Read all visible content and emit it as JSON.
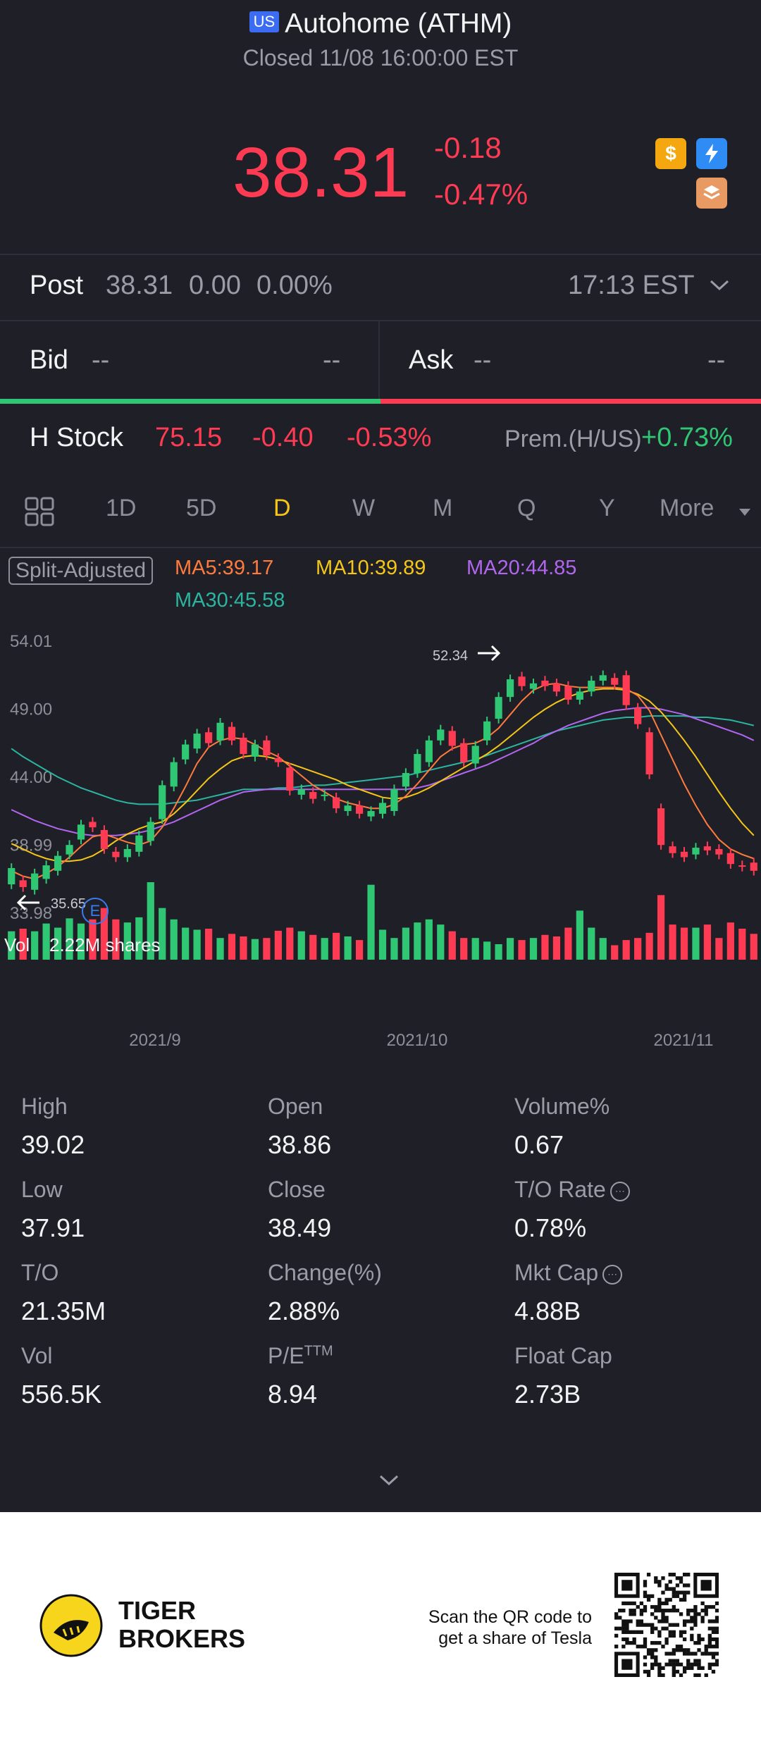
{
  "header": {
    "market_badge": "US",
    "title": "Autohome (ATHM)",
    "status": "Closed 11/08 16:00:00 EST"
  },
  "quote": {
    "price": "38.31",
    "change": "-0.18",
    "change_pct": "-0.47%"
  },
  "post": {
    "label": "Post",
    "price": "38.31",
    "change": "0.00",
    "change_pct": "0.00%",
    "time": "17:13 EST"
  },
  "bid_ask": {
    "bid_label": "Bid",
    "bid_price": "--",
    "bid_size": "--",
    "ask_label": "Ask",
    "ask_price": "--",
    "ask_size": "--"
  },
  "h_stock": {
    "label": "H Stock",
    "price": "75.15",
    "change": "-0.40",
    "change_pct": "-0.53%",
    "prem_label": "Prem.(H/US)",
    "prem_value": "+0.73%"
  },
  "tabs": [
    "1D",
    "5D",
    "D",
    "W",
    "M",
    "Q",
    "Y",
    "More"
  ],
  "active_tab": "D",
  "chart_info": {
    "split_label": "Split-Adjusted",
    "ma5": "MA5:39.17",
    "ma10": "MA10:39.89",
    "ma20": "MA20:44.85",
    "ma30": "MA30:45.58",
    "max_label": "52.34",
    "min_label": "35.65",
    "earnings_marker": "E",
    "vol_label": "Vol",
    "vol_value": "2.22M shares"
  },
  "colors": {
    "up": "#2fc774",
    "down": "#ff3b54",
    "ma5": "#ff7a3d",
    "ma10": "#f5c518",
    "ma20": "#b266f0",
    "ma30": "#2bb5a0"
  },
  "chart_data": {
    "type": "candlestick",
    "y_ticks": [
      "54.01",
      "49.00",
      "44.00",
      "38.99",
      "33.98"
    ],
    "ylim": [
      33.98,
      54.01
    ],
    "x_ticks": [
      "2021/9",
      "2021/10",
      "2021/11"
    ],
    "candles": [
      {
        "o": 36.0,
        "c": 37.2
      },
      {
        "o": 36.3,
        "c": 35.8
      },
      {
        "o": 35.6,
        "c": 36.8
      },
      {
        "o": 36.4,
        "c": 37.4
      },
      {
        "o": 37.0,
        "c": 38.1
      },
      {
        "o": 38.2,
        "c": 38.9
      },
      {
        "o": 39.3,
        "c": 40.4
      },
      {
        "o": 40.6,
        "c": 40.2
      },
      {
        "o": 40.0,
        "c": 38.6
      },
      {
        "o": 38.4,
        "c": 38.0
      },
      {
        "o": 38.0,
        "c": 38.6
      },
      {
        "o": 38.4,
        "c": 39.6
      },
      {
        "o": 39.2,
        "c": 40.6
      },
      {
        "o": 40.8,
        "c": 43.3
      },
      {
        "o": 43.2,
        "c": 45.0
      },
      {
        "o": 45.2,
        "c": 46.3
      },
      {
        "o": 46.0,
        "c": 47.1
      },
      {
        "o": 47.2,
        "c": 46.4
      },
      {
        "o": 46.6,
        "c": 47.9
      },
      {
        "o": 47.6,
        "c": 46.6
      },
      {
        "o": 46.8,
        "c": 45.6
      },
      {
        "o": 45.4,
        "c": 46.3
      },
      {
        "o": 46.6,
        "c": 45.5
      },
      {
        "o": 45.3,
        "c": 45.0
      },
      {
        "o": 44.6,
        "c": 42.9
      },
      {
        "o": 42.6,
        "c": 43.0
      },
      {
        "o": 42.8,
        "c": 42.3
      },
      {
        "o": 42.5,
        "c": 42.6
      },
      {
        "o": 42.4,
        "c": 41.6
      },
      {
        "o": 41.4,
        "c": 41.8
      },
      {
        "o": 41.8,
        "c": 41.2
      },
      {
        "o": 41.0,
        "c": 41.4
      },
      {
        "o": 41.2,
        "c": 42.0
      },
      {
        "o": 41.4,
        "c": 43.0
      },
      {
        "o": 43.2,
        "c": 44.2
      },
      {
        "o": 44.2,
        "c": 45.6
      },
      {
        "o": 45.0,
        "c": 46.6
      },
      {
        "o": 46.6,
        "c": 47.4
      },
      {
        "o": 47.3,
        "c": 46.2
      },
      {
        "o": 46.4,
        "c": 45.0
      },
      {
        "o": 44.9,
        "c": 46.2
      },
      {
        "o": 46.6,
        "c": 48.0
      },
      {
        "o": 48.2,
        "c": 49.8
      },
      {
        "o": 49.8,
        "c": 51.1
      },
      {
        "o": 51.3,
        "c": 50.6
      },
      {
        "o": 50.4,
        "c": 50.8
      },
      {
        "o": 51.0,
        "c": 50.6
      },
      {
        "o": 50.8,
        "c": 50.2
      },
      {
        "o": 50.6,
        "c": 49.6
      },
      {
        "o": 49.6,
        "c": 50.2
      },
      {
        "o": 50.2,
        "c": 51.0
      },
      {
        "o": 51.0,
        "c": 51.4
      },
      {
        "o": 51.2,
        "c": 50.7
      },
      {
        "o": 51.4,
        "c": 49.2
      },
      {
        "o": 49.0,
        "c": 47.8
      },
      {
        "o": 47.2,
        "c": 44.1
      },
      {
        "o": 41.6,
        "c": 38.9
      },
      {
        "o": 38.8,
        "c": 38.3
      },
      {
        "o": 38.4,
        "c": 38.0
      },
      {
        "o": 38.2,
        "c": 38.7
      },
      {
        "o": 38.8,
        "c": 38.5
      },
      {
        "o": 38.6,
        "c": 38.2
      },
      {
        "o": 38.3,
        "c": 37.5
      },
      {
        "o": 37.4,
        "c": 37.3
      },
      {
        "o": 37.6,
        "c": 37.0
      }
    ],
    "volumes": [
      0.55,
      0.6,
      0.55,
      0.7,
      0.62,
      0.8,
      0.7,
      0.78,
      1.0,
      0.78,
      0.72,
      0.82,
      1.5,
      1.0,
      0.78,
      0.62,
      0.58,
      0.6,
      0.42,
      0.5,
      0.45,
      0.4,
      0.42,
      0.56,
      0.62,
      0.55,
      0.48,
      0.42,
      0.52,
      0.45,
      0.38,
      1.45,
      0.58,
      0.42,
      0.62,
      0.72,
      0.78,
      0.68,
      0.55,
      0.42,
      0.42,
      0.35,
      0.3,
      0.42,
      0.38,
      0.42,
      0.48,
      0.45,
      0.62,
      0.95,
      0.62,
      0.42,
      0.28,
      0.38,
      0.42,
      0.52,
      1.25,
      0.68,
      0.62,
      0.62,
      0.68,
      0.42,
      0.72,
      0.6,
      0.5
    ],
    "ma5": [
      37.0,
      36.6,
      36.4,
      36.8,
      37.3,
      38.0,
      38.8,
      39.5,
      39.7,
      39.4,
      39.1,
      38.9,
      39.2,
      40.2,
      41.6,
      43.2,
      44.9,
      46.1,
      46.6,
      46.8,
      46.7,
      46.3,
      45.8,
      45.4,
      44.7,
      44.0,
      43.3,
      42.8,
      42.3,
      42.0,
      41.8,
      41.6,
      41.6,
      41.9,
      42.5,
      43.4,
      44.4,
      45.4,
      46.0,
      46.3,
      46.4,
      46.8,
      47.5,
      48.5,
      49.5,
      50.3,
      50.7,
      50.8,
      50.6,
      50.5,
      50.5,
      50.5,
      50.5,
      50.4,
      49.9,
      48.8,
      47.0,
      45.2,
      43.4,
      41.8,
      40.4,
      39.3,
      38.6,
      38.2,
      37.9
    ],
    "ma10": [
      39.0,
      38.6,
      38.2,
      37.9,
      37.7,
      37.7,
      37.8,
      38.1,
      38.6,
      39.2,
      39.7,
      40.1,
      40.4,
      40.6,
      41.2,
      42.0,
      42.9,
      43.8,
      44.5,
      45.1,
      45.4,
      45.5,
      45.4,
      45.2,
      44.9,
      44.6,
      44.3,
      44.0,
      43.7,
      43.3,
      43.0,
      42.7,
      42.4,
      42.3,
      42.4,
      42.7,
      43.1,
      43.6,
      44.1,
      44.6,
      45.1,
      45.6,
      46.2,
      46.9,
      47.6,
      48.3,
      48.9,
      49.4,
      49.8,
      50.1,
      50.3,
      50.4,
      50.4,
      50.3,
      50.0,
      49.5,
      48.7,
      47.7,
      46.6,
      45.4,
      44.1,
      42.8,
      41.6,
      40.5,
      39.6
    ],
    "ma20": [
      41.5,
      41.1,
      40.7,
      40.4,
      40.1,
      39.9,
      39.7,
      39.6,
      39.6,
      39.6,
      39.7,
      39.8,
      40.0,
      40.3,
      40.6,
      41.0,
      41.4,
      41.8,
      42.2,
      42.5,
      42.8,
      42.9,
      43.0,
      43.0,
      43.0,
      43.0,
      43.0,
      43.0,
      43.0,
      43.0,
      43.0,
      43.0,
      43.0,
      43.0,
      43.0,
      43.1,
      43.3,
      43.6,
      43.9,
      44.2,
      44.5,
      44.8,
      45.2,
      45.6,
      46.0,
      46.4,
      46.9,
      47.3,
      47.7,
      48.0,
      48.3,
      48.6,
      48.8,
      48.9,
      49.0,
      49.0,
      48.9,
      48.7,
      48.5,
      48.2,
      47.9,
      47.6,
      47.3,
      47.0,
      46.6
    ],
    "ma30": [
      46.0,
      45.4,
      44.9,
      44.4,
      43.9,
      43.5,
      43.1,
      42.8,
      42.5,
      42.2,
      42.0,
      41.9,
      41.9,
      41.9,
      42.0,
      42.1,
      42.2,
      42.4,
      42.6,
      42.8,
      43.0,
      43.0,
      43.0,
      43.1,
      43.1,
      43.2,
      43.3,
      43.3,
      43.4,
      43.5,
      43.6,
      43.7,
      43.8,
      43.9,
      44.0,
      44.2,
      44.4,
      44.6,
      44.8,
      45.0,
      45.2,
      45.5,
      45.8,
      46.1,
      46.4,
      46.7,
      47.0,
      47.3,
      47.5,
      47.7,
      47.9,
      48.1,
      48.2,
      48.3,
      48.3,
      48.4,
      48.4,
      48.4,
      48.4,
      48.3,
      48.3,
      48.2,
      48.1,
      47.9,
      47.7
    ]
  },
  "stats": [
    {
      "label": "High",
      "value": "39.02"
    },
    {
      "label": "Open",
      "value": "38.86"
    },
    {
      "label": "Volume%",
      "value": "0.67"
    },
    {
      "label": "Low",
      "value": "37.91"
    },
    {
      "label": "Close",
      "value": "38.49"
    },
    {
      "label": "T/O Rate",
      "value": "0.78%"
    },
    {
      "label": "T/O",
      "value": "21.35M"
    },
    {
      "label": "Change(%)",
      "value": "2.88%"
    },
    {
      "label": "Mkt Cap",
      "value": "4.88B"
    },
    {
      "label": "Vol",
      "value": "556.5K"
    },
    {
      "label": "P/E",
      "value": "8.94"
    },
    {
      "label": "Float Cap",
      "value": "2.73B"
    }
  ],
  "stats_extra": {
    "pe_sup": "TTM"
  },
  "footer": {
    "brand_line1": "TIGER",
    "brand_line2": "BROKERS",
    "promo_line1": "Scan the QR code to",
    "promo_line2": "get a share of Tesla"
  }
}
